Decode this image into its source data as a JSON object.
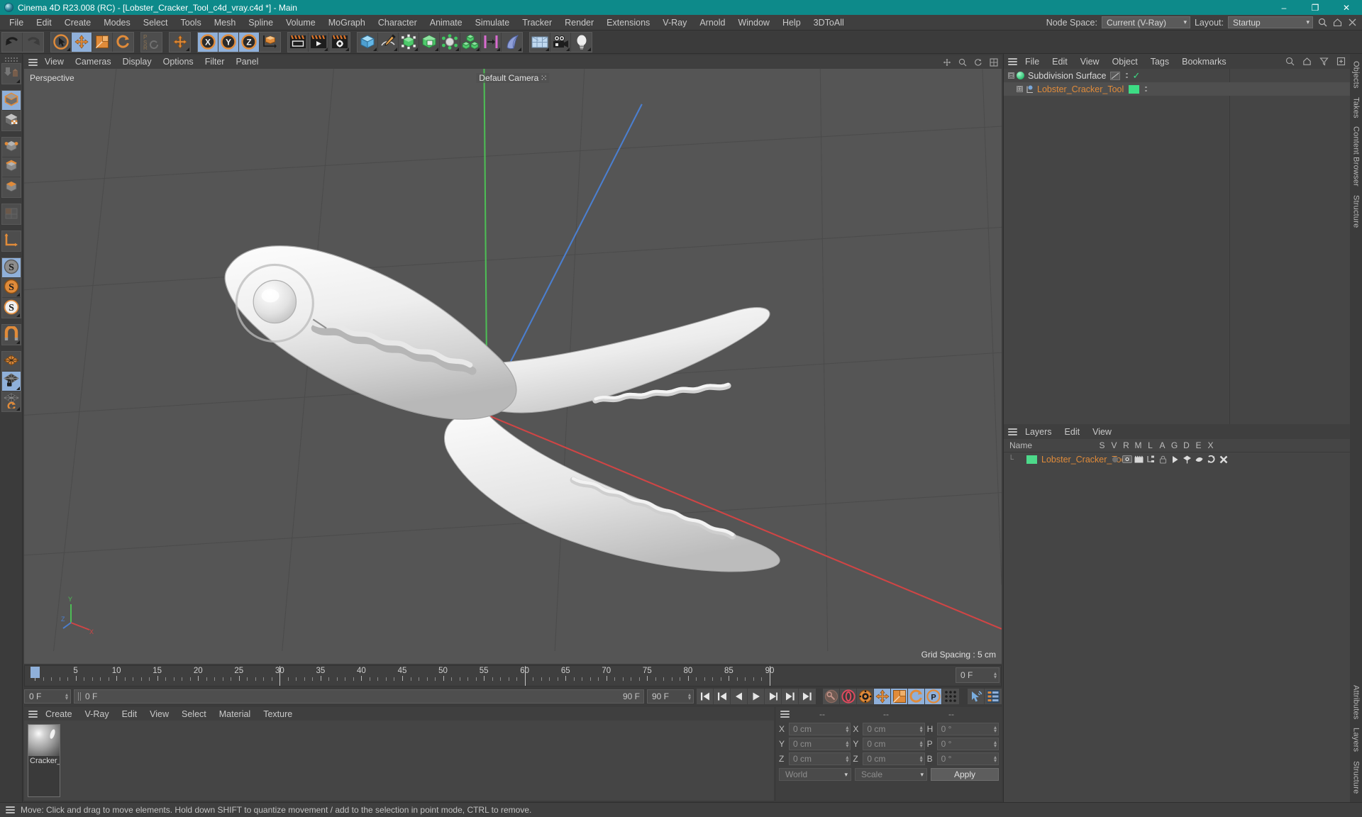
{
  "window": {
    "title": "Cinema 4D R23.008 (RC) - [Lobster_Cracker_Tool_c4d_vray.c4d *] - Main",
    "minimize": "–",
    "maximize": "❐",
    "close": "✕"
  },
  "menubar": {
    "items": [
      "File",
      "Edit",
      "Create",
      "Modes",
      "Select",
      "Tools",
      "Mesh",
      "Spline",
      "Volume",
      "MoGraph",
      "Character",
      "Animate",
      "Simulate",
      "Tracker",
      "Render",
      "Extensions",
      "V-Ray",
      "Arnold",
      "Window",
      "Help",
      "3DToAll"
    ],
    "node_space_label": "Node Space:",
    "node_space_value": "Current (V-Ray)",
    "layout_label": "Layout:",
    "layout_value": "Startup",
    "search_icon": "search-icon",
    "home_icon": "home-icon",
    "close_icon": "close-icon"
  },
  "toolbar": {
    "groups": [
      {
        "name": "history",
        "buttons": [
          {
            "name": "undo-button",
            "icon": "undo-arrow",
            "selected": false,
            "corner": false
          },
          {
            "name": "redo-button",
            "icon": "redo-arrow",
            "selected": false,
            "corner": false
          }
        ]
      },
      {
        "name": "transform",
        "buttons": [
          {
            "name": "select-tool",
            "icon": "cursor-circle",
            "selected": false,
            "corner": true
          },
          {
            "name": "move-tool",
            "icon": "move-arrows",
            "selected": true,
            "corner": false
          },
          {
            "name": "scale-tool",
            "icon": "scale-box",
            "selected": false,
            "corner": false
          },
          {
            "name": "rotate-tool",
            "icon": "rotate-arrows",
            "selected": false,
            "corner": false
          }
        ]
      },
      {
        "name": "psr",
        "buttons": [
          {
            "name": "psr-lock",
            "icon": "psr-letters",
            "selected": false,
            "corner": false
          }
        ]
      },
      {
        "name": "world-move",
        "buttons": [
          {
            "name": "world-move-tool",
            "icon": "move-arrows",
            "selected": false,
            "corner": true
          }
        ]
      },
      {
        "name": "axes",
        "buttons": [
          {
            "name": "axis-x-toggle",
            "icon": "x-circle",
            "selected": true,
            "corner": false
          },
          {
            "name": "axis-y-toggle",
            "icon": "y-circle",
            "selected": true,
            "corner": false
          },
          {
            "name": "axis-z-toggle",
            "icon": "z-circle",
            "selected": true,
            "corner": false
          },
          {
            "name": "coordinate-system-toggle",
            "icon": "axis-cube",
            "selected": false,
            "corner": false
          }
        ]
      },
      {
        "name": "render",
        "buttons": [
          {
            "name": "render-view-button",
            "icon": "render-clapper",
            "selected": false,
            "corner": false
          },
          {
            "name": "render-to-picture-viewer-button",
            "icon": "render-play",
            "selected": false,
            "corner": true
          },
          {
            "name": "render-settings-button",
            "icon": "render-gear",
            "selected": false,
            "corner": true
          }
        ]
      },
      {
        "name": "creation",
        "buttons": [
          {
            "name": "add-cube-button",
            "icon": "blue-cube",
            "selected": false,
            "corner": true
          },
          {
            "name": "add-spline-button",
            "icon": "pen-spline",
            "selected": false,
            "corner": true
          },
          {
            "name": "add-nurbs-button",
            "icon": "green-cage-cube",
            "selected": false,
            "corner": true
          },
          {
            "name": "add-modeling-object-button",
            "icon": "green-open-cube",
            "selected": false,
            "corner": true
          },
          {
            "name": "add-deformer-button",
            "icon": "gray-atom",
            "selected": false,
            "corner": true
          },
          {
            "name": "add-mograph-button",
            "icon": "green-cubes",
            "selected": false,
            "corner": true
          },
          {
            "name": "add-field-button",
            "icon": "pink-bars",
            "selected": false,
            "corner": true
          },
          {
            "name": "add-cloth-button",
            "icon": "blue-cloth",
            "selected": false,
            "corner": true
          }
        ]
      },
      {
        "name": "scene",
        "buttons": [
          {
            "name": "add-environment-button",
            "icon": "floor-grid",
            "selected": false,
            "corner": true
          },
          {
            "name": "add-camera-button",
            "icon": "camera",
            "selected": false,
            "corner": true
          },
          {
            "name": "add-light-button",
            "icon": "light-bulb",
            "selected": false,
            "corner": true
          }
        ]
      }
    ]
  },
  "leftbar": {
    "groups": [
      {
        "name": "g-makeeditable",
        "buttons": [
          {
            "name": "make-editable-button",
            "icon": "convert-cubes",
            "selected": false,
            "corner": true
          }
        ]
      },
      {
        "name": "g-modes",
        "buttons": [
          {
            "name": "model-mode-button",
            "icon": "model-cube",
            "selected": true,
            "corner": false
          },
          {
            "name": "texture-mode-button",
            "icon": "texture-cube",
            "selected": false,
            "corner": false
          }
        ]
      },
      {
        "name": "g-components",
        "buttons": [
          {
            "name": "points-mode-button",
            "icon": "point-cube",
            "selected": false,
            "corner": false
          },
          {
            "name": "edges-mode-button",
            "icon": "edge-cube",
            "selected": false,
            "corner": false
          },
          {
            "name": "polygons-mode-button",
            "icon": "polygon-cube",
            "selected": false,
            "corner": false
          }
        ]
      },
      {
        "name": "g-uv",
        "buttons": [
          {
            "name": "uv-mode-button",
            "icon": "uv-grid",
            "selected": false,
            "corner": false
          }
        ]
      },
      {
        "name": "g-axis",
        "buttons": [
          {
            "name": "enable-axis-button",
            "icon": "axis-l",
            "selected": false,
            "corner": false
          }
        ]
      },
      {
        "name": "g-snap",
        "buttons": [
          {
            "name": "snap-off-button",
            "icon": "s-gray",
            "selected": true,
            "corner": false
          },
          {
            "name": "snap-on-button",
            "icon": "s-orange",
            "selected": false,
            "corner": true
          },
          {
            "name": "snap-settings-button",
            "icon": "s-white",
            "selected": false,
            "corner": true
          }
        ]
      },
      {
        "name": "g-magnet",
        "buttons": [
          {
            "name": "magnet-tool-button",
            "icon": "magnet",
            "selected": false,
            "corner": true
          }
        ]
      },
      {
        "name": "g-workplane",
        "buttons": [
          {
            "name": "workplane-button",
            "icon": "orange-grid",
            "selected": false,
            "corner": false
          },
          {
            "name": "lock-workplane-button",
            "icon": "locked-grid",
            "selected": true,
            "corner": true
          },
          {
            "name": "align-workplane-button",
            "icon": "rotate-grid",
            "selected": false,
            "corner": true
          }
        ]
      }
    ]
  },
  "viewport": {
    "menu": [
      "View",
      "Cameras",
      "Display",
      "Options",
      "Filter",
      "Panel"
    ],
    "projection_label": "Perspective",
    "camera_label": "Default Camera",
    "grid_spacing": "Grid Spacing : 5 cm",
    "axis_labels": {
      "x": "X",
      "y": "Y",
      "z": "Z"
    },
    "header_icons": [
      "pan-icon",
      "zoom-icon",
      "rotate-icon",
      "maximize-icon"
    ]
  },
  "timeline": {
    "ticks": [
      0,
      5,
      10,
      15,
      20,
      25,
      30,
      35,
      40,
      45,
      50,
      55,
      60,
      65,
      70,
      75,
      80,
      85,
      90
    ],
    "current_frame": "0 F",
    "current_frame_right": "0 F",
    "range_start": "0 F",
    "range_end": "90 F",
    "preview_start": "0 F",
    "preview_end": "90 F",
    "transport": [
      {
        "name": "goto-start-button",
        "icon": "skip-start"
      },
      {
        "name": "prev-key-button",
        "icon": "prev-key"
      },
      {
        "name": "step-back-button",
        "icon": "step-back"
      },
      {
        "name": "play-button",
        "icon": "play"
      },
      {
        "name": "step-forward-button",
        "icon": "step-forward"
      },
      {
        "name": "next-key-button",
        "icon": "next-key"
      },
      {
        "name": "goto-end-button",
        "icon": "skip-end"
      }
    ],
    "record_tools": [
      {
        "name": "autokey-button",
        "icon": "key-gray",
        "selected": false
      },
      {
        "name": "record-button",
        "icon": "record-red",
        "selected": false
      },
      {
        "name": "keyframe-settings-button",
        "icon": "gear-orange",
        "selected": false
      },
      {
        "name": "record-position-button",
        "icon": "move-arrows",
        "selected": true
      },
      {
        "name": "record-scale-button",
        "icon": "scale-box",
        "selected": true
      },
      {
        "name": "record-rotation-button",
        "icon": "rotate-arrows",
        "selected": true
      },
      {
        "name": "record-parameter-button",
        "icon": "p-circle",
        "selected": true
      },
      {
        "name": "record-pla-button",
        "icon": "point-dots",
        "selected": false
      }
    ],
    "extra_tools": [
      {
        "name": "animation-mode-button",
        "icon": "cursor-waves"
      },
      {
        "name": "timeline-settings-button",
        "icon": "timeline-bars"
      }
    ]
  },
  "material_manager": {
    "menu": [
      "Create",
      "V-Ray",
      "Edit",
      "View",
      "Select",
      "Material",
      "Texture"
    ],
    "materials": [
      {
        "name": "Cracker_",
        "preview": "gray-glossy-sphere"
      }
    ]
  },
  "coordinates": {
    "header": [
      "--",
      "--",
      "--"
    ],
    "rows": [
      {
        "pos_label": "X",
        "pos_value": "0 cm",
        "size_label": "X",
        "size_value": "0 cm",
        "rot_label": "H",
        "rot_value": "0 °"
      },
      {
        "pos_label": "Y",
        "pos_value": "0 cm",
        "size_label": "Y",
        "size_value": "0 cm",
        "rot_label": "P",
        "rot_value": "0 °"
      },
      {
        "pos_label": "Z",
        "pos_value": "0 cm",
        "size_label": "Z",
        "size_value": "0 cm",
        "rot_label": "B",
        "rot_value": "0 °"
      }
    ],
    "system": "World",
    "mode": "Scale",
    "apply_label": "Apply"
  },
  "object_manager": {
    "menu": [
      "File",
      "Edit",
      "View",
      "Object",
      "Tags",
      "Bookmarks"
    ],
    "header_icons": [
      "search-icon",
      "home-icon",
      "filter-icon",
      "add-icon"
    ],
    "objects": [
      {
        "name": "Subdivision Surface",
        "indent": 0,
        "dot_color": "#3ddc84",
        "visible_dash": true,
        "check": true,
        "selected": false
      },
      {
        "name": "Lobster_Cracker_Tool",
        "indent": 1,
        "dot_color": "#7aa7d8",
        "tag_color": "#3ddc84",
        "selected": true
      }
    ]
  },
  "layers": {
    "menu": [
      "Layers",
      "Edit",
      "View"
    ],
    "columns": [
      "Name",
      "S",
      "V",
      "R",
      "M",
      "L",
      "A",
      "G",
      "D",
      "E",
      "X"
    ],
    "rows": [
      {
        "name": "Lobster_Cracker_Tool",
        "color": "#3ddc84",
        "icons": [
          "solo-dot",
          "eye-icon",
          "render-icon",
          "manager-icon",
          "lock-icon",
          "animation-icon",
          "generator-icon",
          "deformer-icon",
          "expression-icon",
          "xref-icon"
        ]
      }
    ]
  },
  "rails": {
    "right_top": [
      "Objects",
      "Takes",
      "Content Browser",
      "Structure"
    ],
    "right_bottom": [
      "Attributes",
      "Layers",
      "Structure"
    ]
  },
  "status": {
    "message": "Move: Click and drag to move elements. Hold down SHIFT to quantize movement / add to the selection in point mode, CTRL to remove."
  },
  "colors": {
    "accent_teal": "#0d8a8a",
    "selection_blue": "#8fb0da",
    "orange": "#e08b3a",
    "green": "#3ddc84",
    "axis_x": "#d04545",
    "axis_y": "#4dbd55",
    "axis_z": "#4b7fd0"
  }
}
